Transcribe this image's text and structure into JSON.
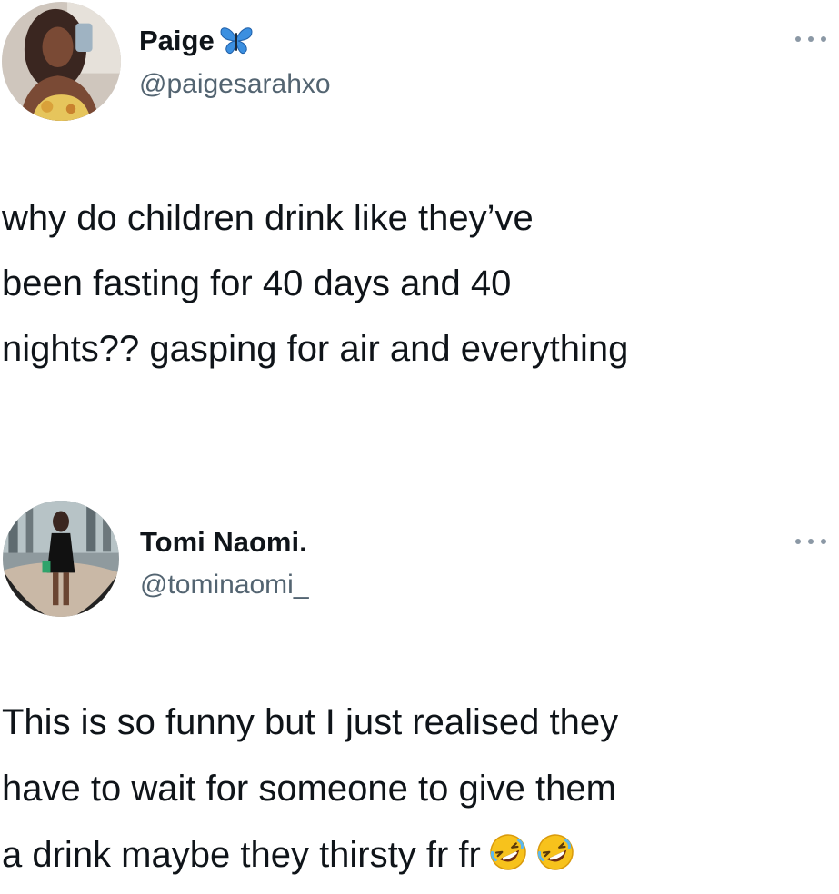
{
  "tweets": [
    {
      "display_name": "Paige",
      "name_badge_icon": "butterfly-icon",
      "handle": "@paigesarahxo",
      "text": "why do children drink like they’ve\nbeen fasting for 40 days and 40\nnights?? gasping for air and everything"
    },
    {
      "display_name": "Tomi Naomi.",
      "handle": "@tominaomi_",
      "text": "This is so funny but I just realised they\nhave to wait for someone to give them\na drink maybe they thirsty fr fr",
      "trailing_emoji": [
        "rolling-on-floor-laughing-emoji",
        "rolling-on-floor-laughing-emoji"
      ]
    }
  ],
  "colors": {
    "text_primary": "#0f1419",
    "text_secondary": "#536471",
    "more_dots": "#8b98a5",
    "butterfly_blue": "#3b8fe0"
  }
}
